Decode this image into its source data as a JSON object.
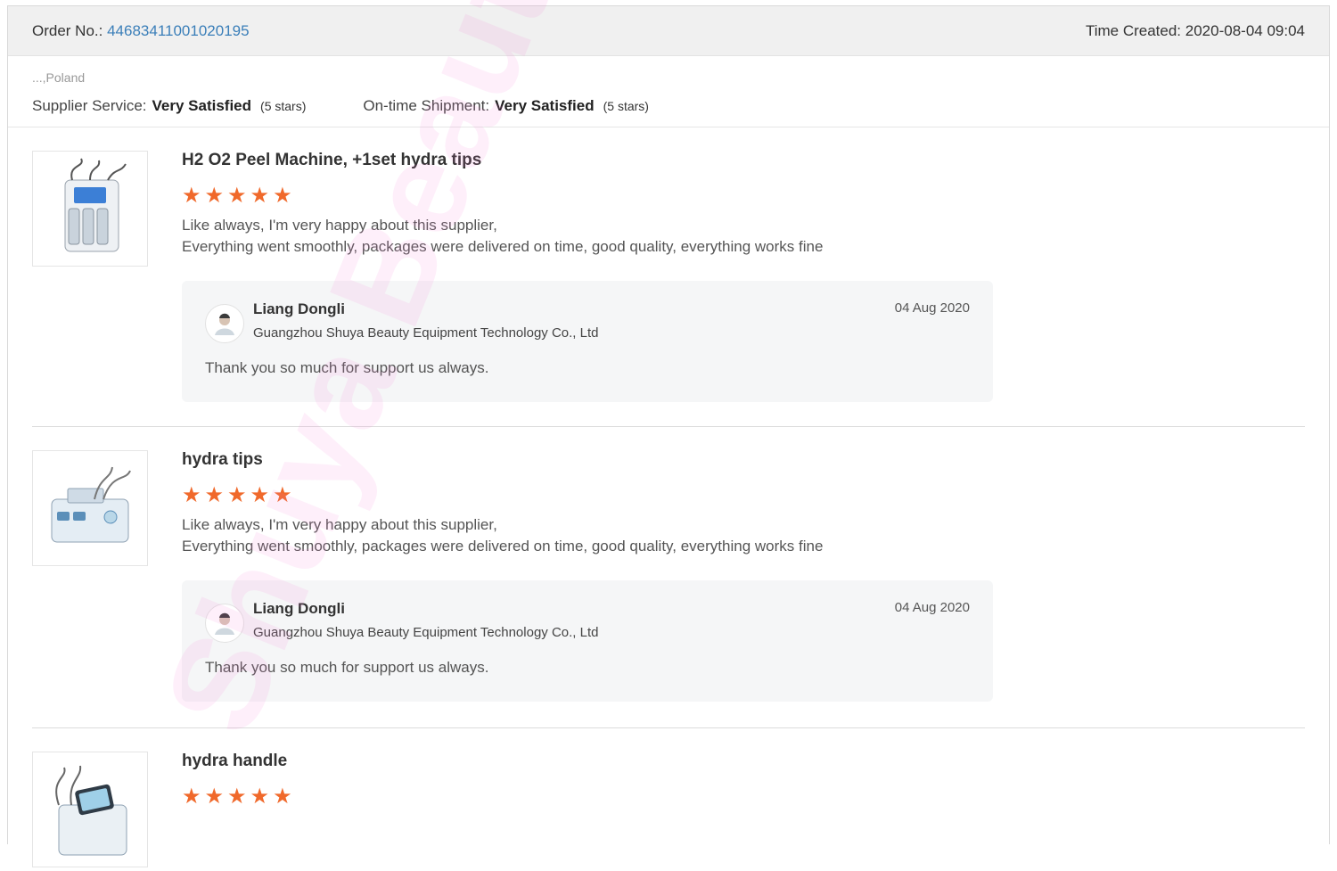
{
  "order": {
    "number_label": "Order No.:",
    "number_value": "44683411001020195",
    "time_label": "Time Created:",
    "time_value": "2020-08-04 09:04"
  },
  "buyer": {
    "location": "...,Poland",
    "supplier_service_label": "Supplier Service:",
    "supplier_service_value": "Very Satisfied",
    "supplier_service_stars": "(5 stars)",
    "shipment_label": "On-time Shipment:",
    "shipment_value": "Very Satisfied",
    "shipment_stars": "(5 stars)"
  },
  "reviews": [
    {
      "product": "H2 O2 Peel Machine, +1set hydra tips",
      "rating": 5,
      "comment_line1": "Like always, I'm very happy about this supplier,",
      "comment_line2": "Everything went smoothly, packages were delivered on time, good quality, everything works fine",
      "reply": {
        "name": "Liang Dongli",
        "company": "Guangzhou Shuya Beauty Equipment Technology Co., Ltd",
        "date": "04 Aug 2020",
        "text": "Thank you so much for support us always."
      }
    },
    {
      "product": "hydra tips",
      "rating": 5,
      "comment_line1": "Like always, I'm very happy about this supplier,",
      "comment_line2": "Everything went smoothly, packages were delivered on time, good quality, everything works fine",
      "reply": {
        "name": "Liang Dongli",
        "company": "Guangzhou Shuya Beauty Equipment Technology Co., Ltd",
        "date": "04 Aug 2020",
        "text": "Thank you so much for support us always."
      }
    },
    {
      "product": "hydra handle",
      "rating": 5
    }
  ],
  "star_glyph": "★",
  "watermark": "Shuya Beauty",
  "colors": {
    "star": "#f0692b",
    "order_link": "#3b7fb9"
  }
}
